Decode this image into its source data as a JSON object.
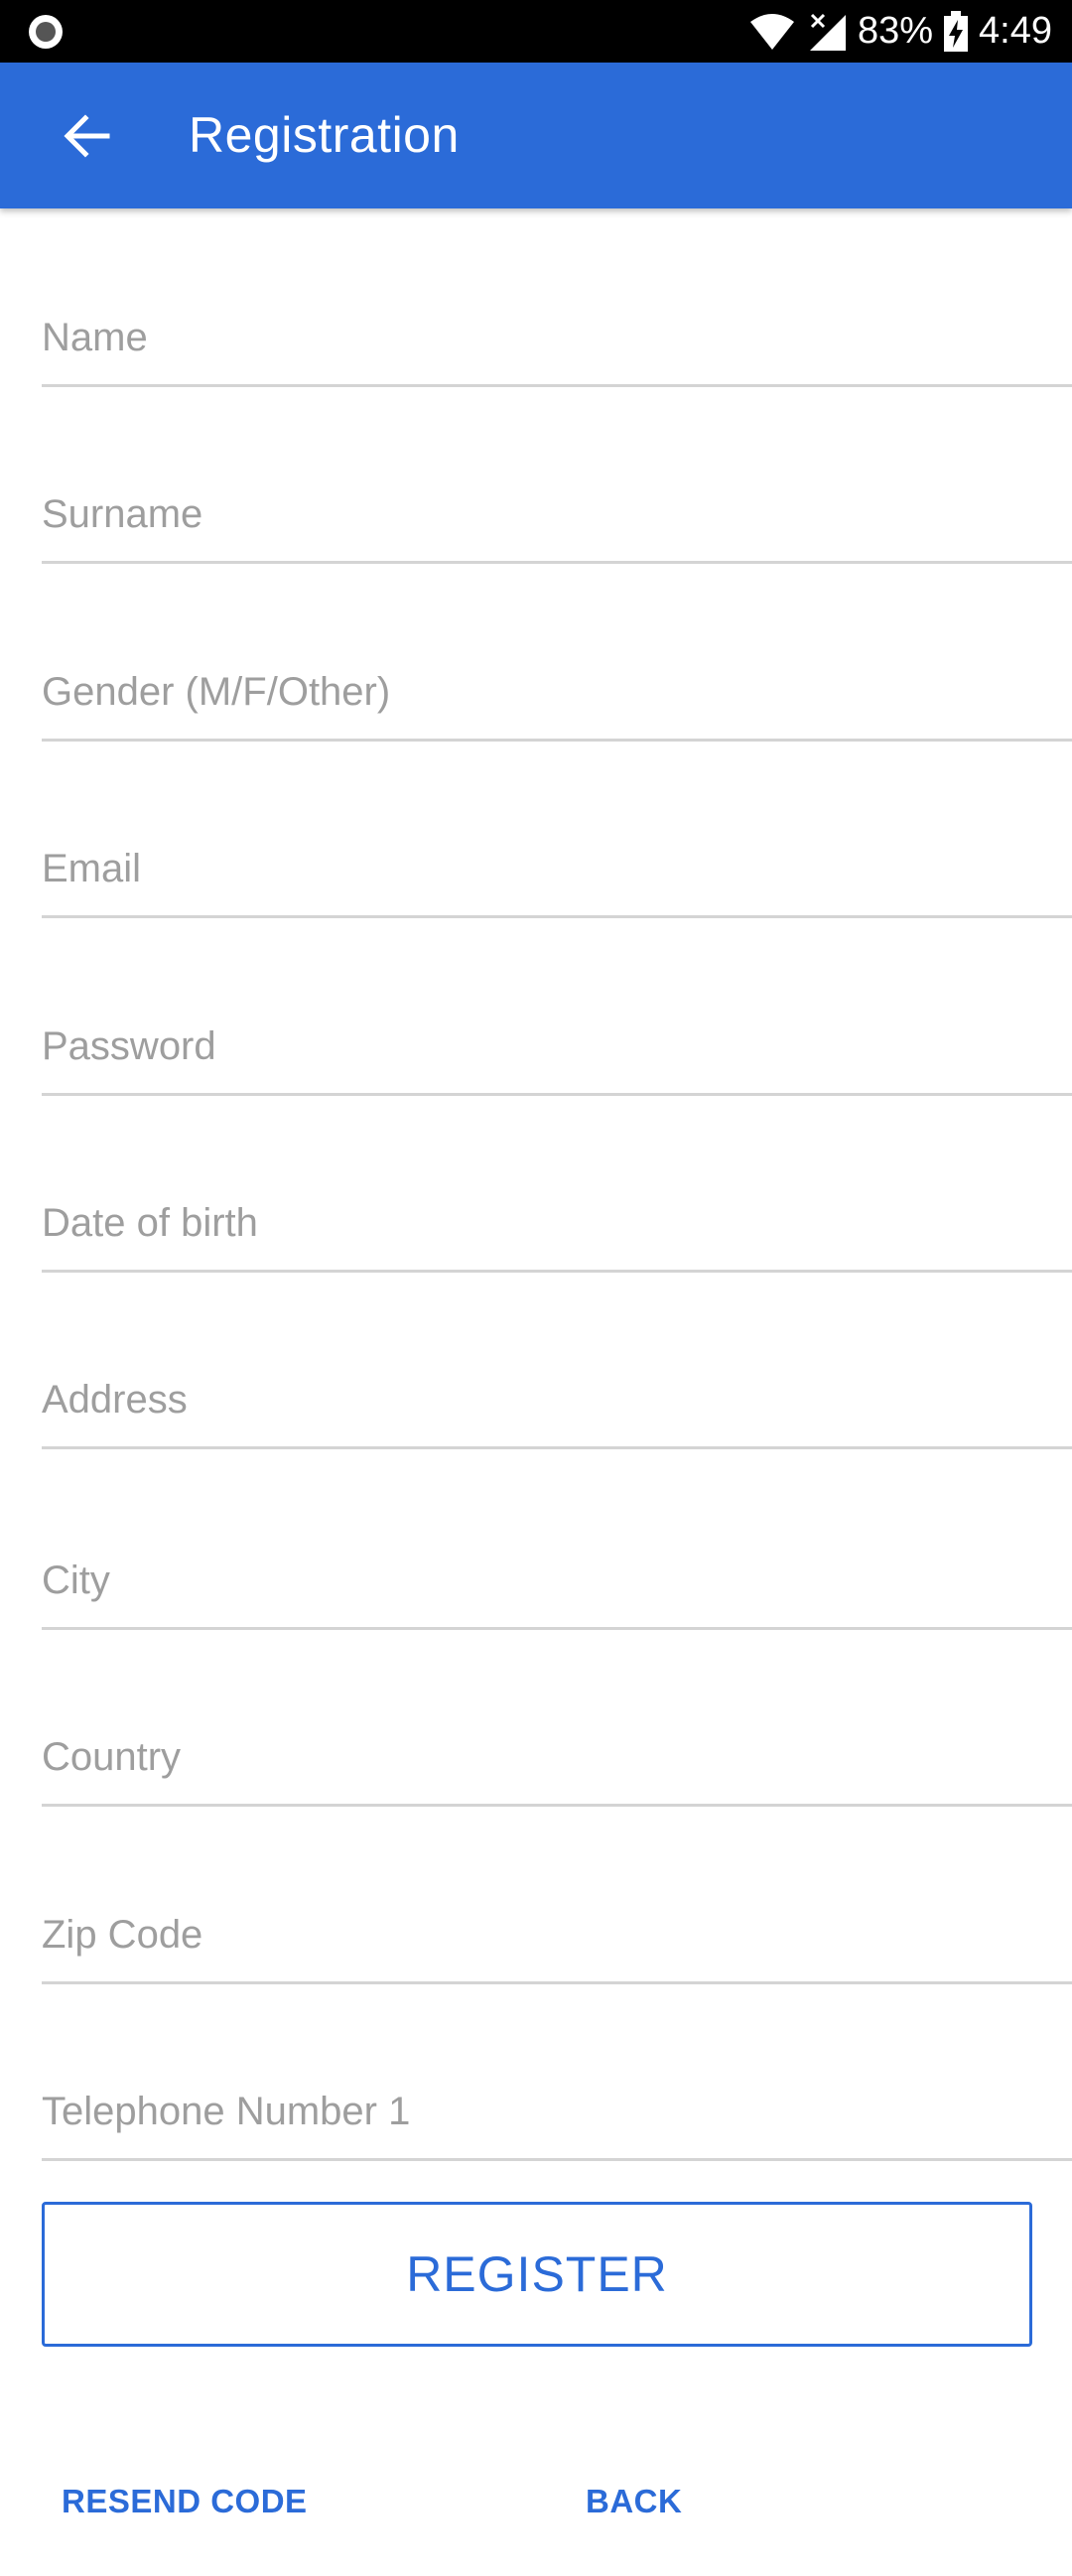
{
  "status_bar": {
    "battery": "83%",
    "time": "4:49"
  },
  "app_bar": {
    "title": "Registration",
    "back_icon": "arrow-left-icon"
  },
  "form": {
    "fields": [
      {
        "placeholder": "Name",
        "value": ""
      },
      {
        "placeholder": "Surname",
        "value": ""
      },
      {
        "placeholder": "Gender (M/F/Other)",
        "value": ""
      },
      {
        "placeholder": "Email",
        "value": ""
      },
      {
        "placeholder": "Password",
        "value": ""
      },
      {
        "placeholder": "Date of birth",
        "value": ""
      },
      {
        "placeholder": "Address",
        "value": ""
      },
      {
        "placeholder": "City",
        "value": ""
      },
      {
        "placeholder": "Country",
        "value": ""
      },
      {
        "placeholder": "Zip Code",
        "value": ""
      },
      {
        "placeholder": "Telephone Number 1",
        "value": ""
      }
    ]
  },
  "actions": {
    "register_label": "REGISTER",
    "resend_label": "RESEND CODE",
    "back_label": "BACK"
  },
  "colors": {
    "primary": "#2b6bd8",
    "status_bar": "#000000",
    "placeholder": "#9e9e9e",
    "divider": "#d4d4d4"
  }
}
